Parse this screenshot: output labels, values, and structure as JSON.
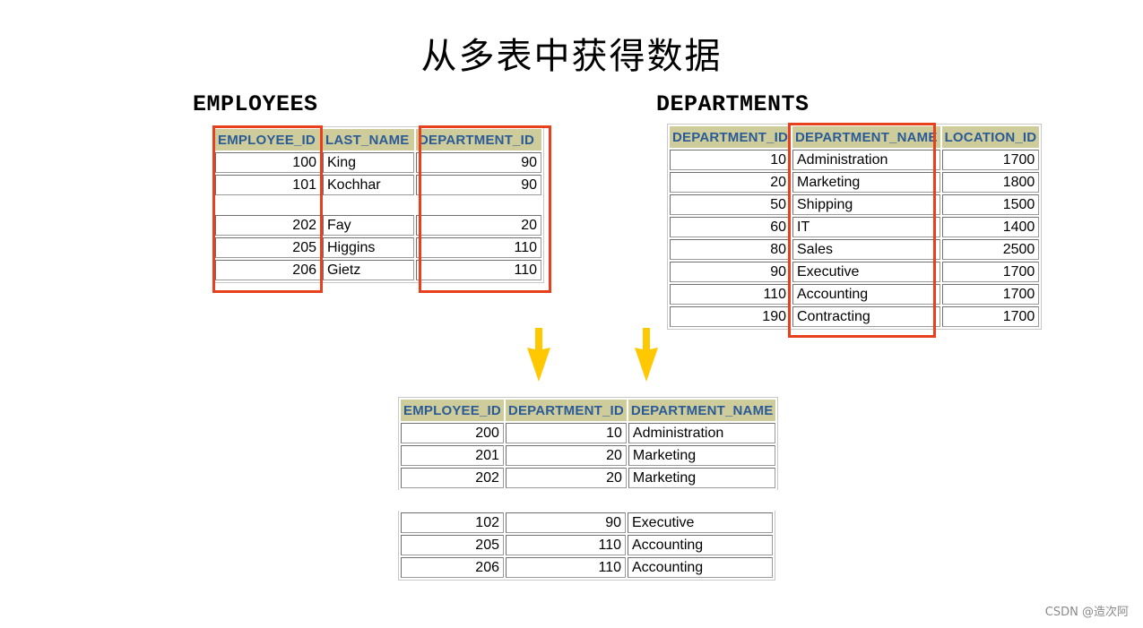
{
  "title": "从多表中获得数据",
  "employees": {
    "label": "EMPLOYEES",
    "columns": [
      "EMPLOYEE_ID",
      "LAST_NAME",
      "DEPARTMENT_ID"
    ],
    "rows_top": [
      [
        "100",
        "King",
        "90"
      ],
      [
        "101",
        "Kochhar",
        "90"
      ]
    ],
    "rows_bottom": [
      [
        "202",
        "Fay",
        "20"
      ],
      [
        "205",
        "Higgins",
        "110"
      ],
      [
        "206",
        "Gietz",
        "110"
      ]
    ]
  },
  "departments": {
    "label": "DEPARTMENTS",
    "columns": [
      "DEPARTMENT_ID",
      "DEPARTMENT_NAME",
      "LOCATION_ID"
    ],
    "rows": [
      [
        "10",
        "Administration",
        "1700"
      ],
      [
        "20",
        "Marketing",
        "1800"
      ],
      [
        "50",
        "Shipping",
        "1500"
      ],
      [
        "60",
        "IT",
        "1400"
      ],
      [
        "80",
        "Sales",
        "2500"
      ],
      [
        "90",
        "Executive",
        "1700"
      ],
      [
        "110",
        "Accounting",
        "1700"
      ],
      [
        "190",
        "Contracting",
        "1700"
      ]
    ]
  },
  "result": {
    "columns": [
      "EMPLOYEE_ID",
      "DEPARTMENT_ID",
      "DEPARTMENT_NAME"
    ],
    "rows_top": [
      [
        "200",
        "10",
        "Administration"
      ],
      [
        "201",
        "20",
        "Marketing"
      ],
      [
        "202",
        "20",
        "Marketing"
      ]
    ],
    "rows_bottom": [
      [
        "102",
        "90",
        "Executive"
      ],
      [
        "205",
        "110",
        "Accounting"
      ],
      [
        "206",
        "110",
        "Accounting"
      ]
    ]
  },
  "colors": {
    "highlight": "#e8401c",
    "arrow": "#ffc800",
    "header_bg": "#cfcc9c",
    "header_text": "#2b5b96"
  },
  "footer": "CSDN @造次阿"
}
